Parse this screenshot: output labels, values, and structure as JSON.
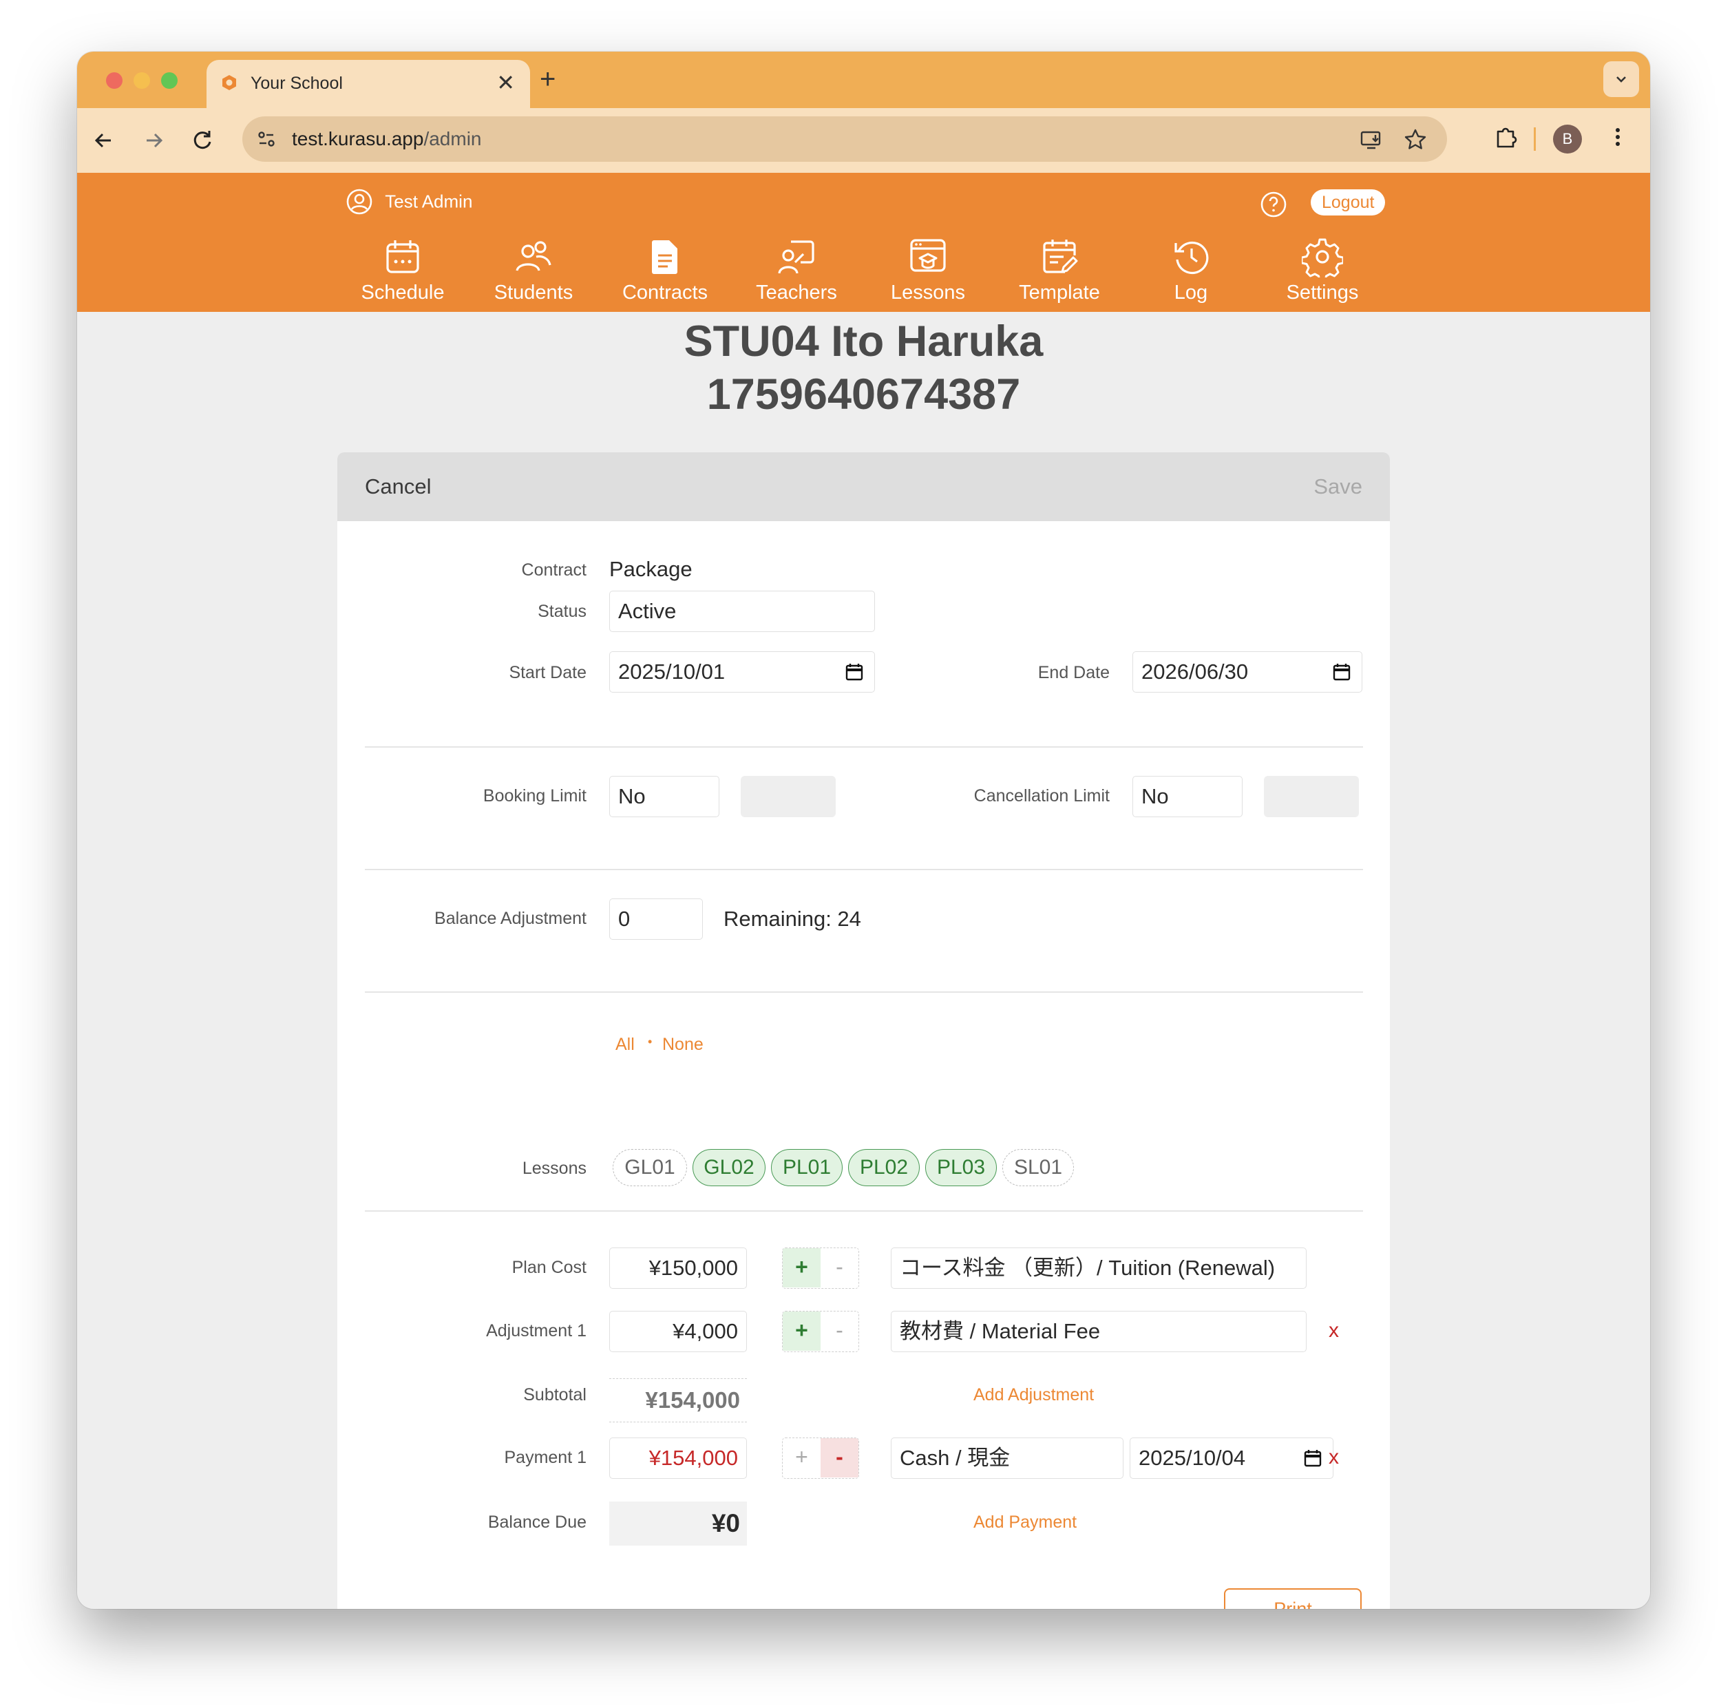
{
  "browser": {
    "tab_title": "Your School",
    "tab_close": "✕",
    "new_tab": "+",
    "url_host": "test.kurasu.app",
    "url_path": "/admin",
    "profile_initial": "B"
  },
  "header": {
    "user_name": "Test Admin",
    "logout_label": "Logout",
    "nav": [
      {
        "label": "Schedule",
        "icon": "calendar-icon"
      },
      {
        "label": "Students",
        "icon": "students-icon"
      },
      {
        "label": "Contracts",
        "icon": "document-icon"
      },
      {
        "label": "Teachers",
        "icon": "teacher-icon"
      },
      {
        "label": "Lessons",
        "icon": "lessons-icon"
      },
      {
        "label": "Template",
        "icon": "template-icon"
      },
      {
        "label": "Log",
        "icon": "history-icon"
      },
      {
        "label": "Settings",
        "icon": "gear-icon"
      }
    ],
    "accent_color": "#ec8834"
  },
  "page": {
    "title_line1": "STU04 Ito Haruka",
    "title_line2": "1759640674387"
  },
  "form": {
    "cancel_label": "Cancel",
    "save_label": "Save",
    "contract_label": "Contract",
    "contract_value": "Package",
    "status_label": "Status",
    "status_value": "Active",
    "start_date_label": "Start Date",
    "start_date_value": "2025/10/01",
    "end_date_label": "End Date",
    "end_date_value": "2026/06/30",
    "booking_limit_label": "Booking Limit",
    "booking_limit_value": "No",
    "cancellation_limit_label": "Cancellation Limit",
    "cancellation_limit_value": "No",
    "balance_adjustment_label": "Balance Adjustment",
    "balance_adjustment_value": "0",
    "remaining_text": "Remaining: 24",
    "select_all": "All",
    "select_sep": "•",
    "select_none": "None",
    "lessons_label": "Lessons",
    "lessons": [
      {
        "code": "GL01",
        "selected": false
      },
      {
        "code": "GL02",
        "selected": true
      },
      {
        "code": "PL01",
        "selected": true
      },
      {
        "code": "PL02",
        "selected": true
      },
      {
        "code": "PL03",
        "selected": true
      },
      {
        "code": "SL01",
        "selected": false
      }
    ],
    "plan_cost_label": "Plan Cost",
    "plan_cost_value": "¥150,000",
    "plan_cost_desc": "コース料金 （更新）/ Tuition (Renewal)",
    "adjustment1_label": "Adjustment 1",
    "adjustment1_value": "¥4,000",
    "adjustment1_desc": "教材費 / Material Fee",
    "subtotal_label": "Subtotal",
    "subtotal_value": "¥154,000",
    "add_adjustment": "Add Adjustment",
    "payment1_label": "Payment 1",
    "payment1_value": "¥154,000",
    "payment1_method": "Cash / 現金",
    "payment1_date": "2025/10/04",
    "balance_due_label": "Balance Due",
    "balance_due_value": "¥0",
    "add_payment": "Add Payment",
    "print_label": "Print",
    "plus_symbol": "+",
    "minus_symbol": "-",
    "remove_symbol": "x"
  }
}
